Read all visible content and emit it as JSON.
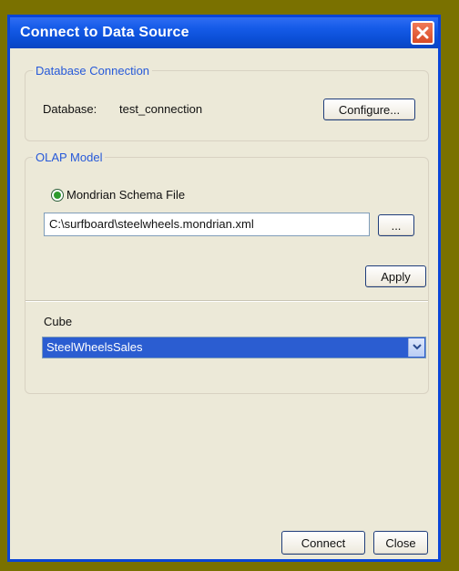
{
  "window": {
    "title": "Connect to Data Source"
  },
  "database_connection": {
    "legend": "Database Connection",
    "database_label": "Database:",
    "database_value": "test_connection",
    "configure_label": "Configure..."
  },
  "olap_model": {
    "legend": "OLAP Model",
    "schema_radio_label": "Mondrian Schema File",
    "schema_path": "C:\\surfboard\\steelwheels.mondrian.xml",
    "browse_label": "...",
    "apply_label": "Apply",
    "cube_label": "Cube",
    "cube_selected": "SteelWheelsSales"
  },
  "footer": {
    "connect_label": "Connect",
    "close_label": "Close"
  },
  "icons": {
    "close": "close-icon",
    "radio": "radio-selected-icon",
    "dropdown": "chevron-down-icon"
  },
  "colors": {
    "titlebar": "#155be8",
    "close_button": "#d84a26",
    "legend_text": "#2659d9",
    "selection": "#2b5dd1",
    "window_bg": "#ece9d8",
    "outer_frame": "#7a7100"
  }
}
